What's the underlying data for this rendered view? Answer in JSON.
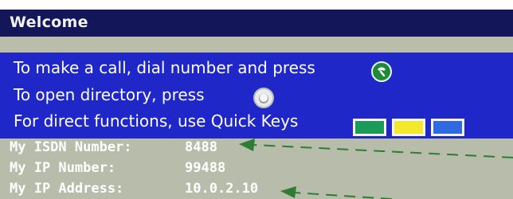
{
  "window": {
    "title": "Welcome"
  },
  "instructions": {
    "call": "To make a call, dial number and press",
    "directory": "To open directory, press",
    "quick_keys": "For direct functions, use Quick Keys"
  },
  "icons": {
    "call": "phone-handset-icon",
    "directory": "directory-button-icon",
    "quick_keys": [
      "green-quick-key",
      "yellow-quick-key",
      "blue-quick-key"
    ]
  },
  "info": {
    "isdn_label": "My ISDN Number:",
    "isdn_value": "8488",
    "ip_number_label": "My IP Number:",
    "ip_number_value": "99488",
    "ip_address_label": "My IP Address:",
    "ip_address_value": "10.0.2.10"
  },
  "colors": {
    "title_bar": "#131658",
    "panel_blue": "#1f27c8",
    "panel_gray": "#b8bcaa",
    "arrow_green": "#2e7d32"
  }
}
